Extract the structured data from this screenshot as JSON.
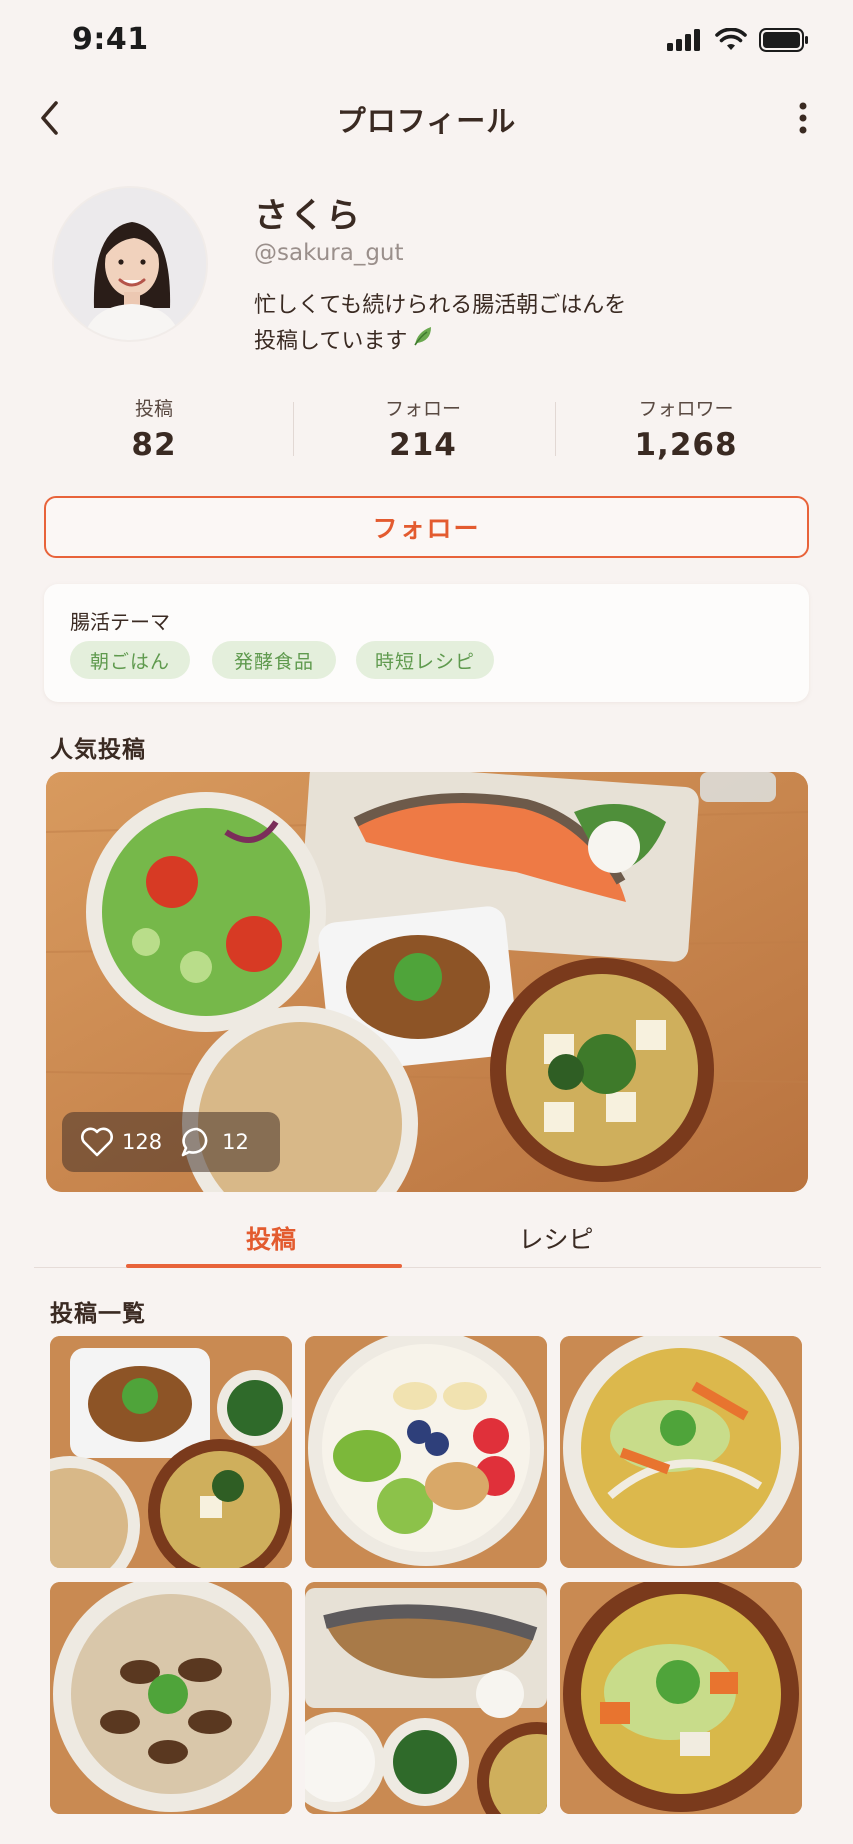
{
  "status_bar": {
    "time": "9:41"
  },
  "nav": {
    "title": "プロフィール"
  },
  "profile": {
    "name": "さくら",
    "handle": "@sakura_gut",
    "bio_line1": "忙しくても続けられる腸活朝ごはんを",
    "bio_line2": "投稿しています"
  },
  "stats": [
    {
      "label": "投稿",
      "value": "82"
    },
    {
      "label": "フォロー",
      "value": "214"
    },
    {
      "label": "フォロワー",
      "value": "1,268"
    }
  ],
  "follow_button": "フォロー",
  "theme": {
    "title": "腸活テーマ",
    "tags": [
      "朝ごはん",
      "発酵食品",
      "時短レシピ"
    ]
  },
  "popular": {
    "heading": "人気投稿",
    "likes": "128",
    "comments": "12"
  },
  "tabs": [
    {
      "label": "投稿",
      "active": true
    },
    {
      "label": "レシピ",
      "active": false
    }
  ],
  "posts_heading": "投稿一覧",
  "colors": {
    "accent": "#e8633a",
    "tag_bg": "#e4efdc",
    "tag_text": "#5f9a4e",
    "background": "#f8f3f1"
  },
  "icons": [
    "back-chevron-icon",
    "more-vertical-icon",
    "heart-icon",
    "comment-icon",
    "leaf-icon",
    "signal-icon",
    "wifi-icon",
    "battery-icon"
  ]
}
